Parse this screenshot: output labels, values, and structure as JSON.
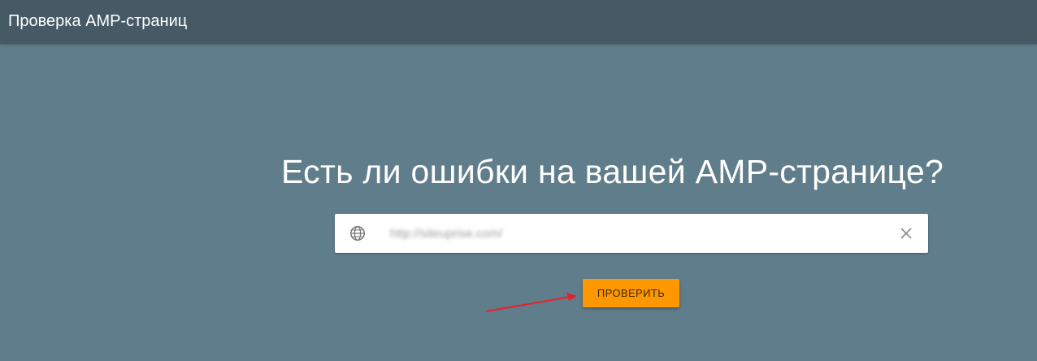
{
  "header": {
    "title": "Проверка AMP-страниц"
  },
  "main": {
    "headline": "Есть ли ошибки на вашей AMP-странице?",
    "url_input": {
      "value": "http://siteuprise.com/",
      "icon": "globe-icon",
      "clear_icon": "close-icon"
    },
    "check_button_label": "ПРОВЕРИТЬ"
  },
  "annotation": {
    "arrow_color": "#e8202a"
  },
  "colors": {
    "header_bg": "#455a64",
    "page_bg": "#607d8b",
    "accent": "#ff9800"
  }
}
